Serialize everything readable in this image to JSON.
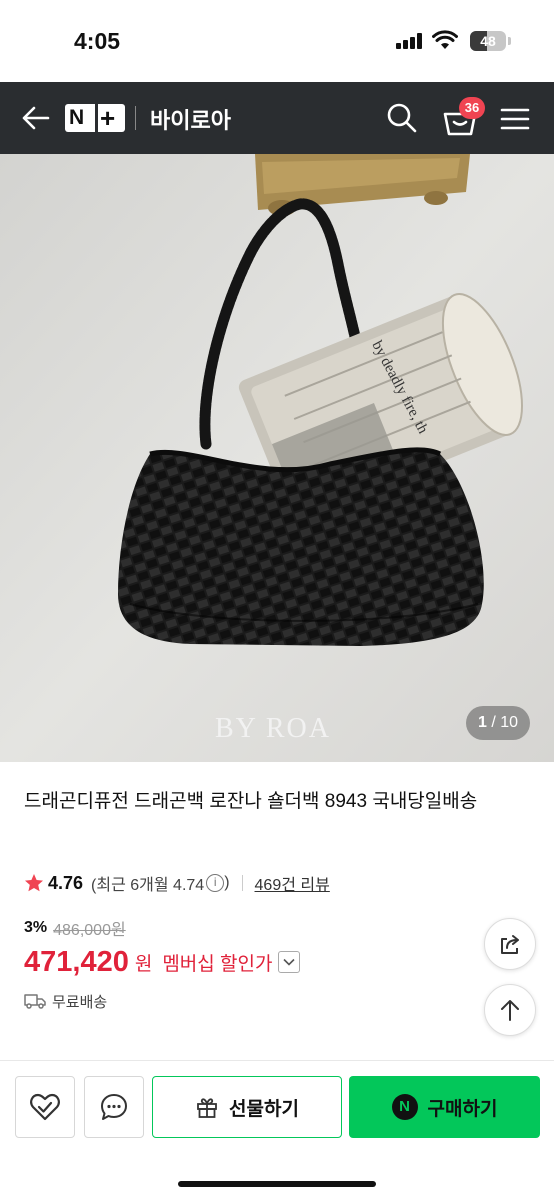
{
  "status_bar": {
    "time": "4:05",
    "battery": "48",
    "battery_level": 0.48
  },
  "header": {
    "back_icon": "arrow-left-icon",
    "logo_n": "N",
    "logo_plus": "+",
    "store_name": "바이로아",
    "cart_count": "36",
    "colors": {
      "background": "#2a2d30",
      "badge": "#f04452"
    }
  },
  "image": {
    "watermark": "BY ROA",
    "newspaper_text": "by deadly fire, th",
    "counter_current": "1",
    "counter_total": "/ 10"
  },
  "product": {
    "title": "드래곤디퓨전 드래곤백 로잔나 숄더백 8943 국내당일배송",
    "rating": "4.76",
    "recent_rating": "(최근 6개월 4.74",
    "recent_rating_close": ")",
    "info_mark": "i",
    "reviews": "469건 리뷰",
    "discount_rate": "3%",
    "original_price": "486,000원",
    "price": "471,420",
    "price_unit": "원",
    "price_label": "멤버십 할인가",
    "shipping": "무료배송",
    "colors": {
      "price": "#e0223a",
      "star": "#f04452"
    }
  },
  "bottom_bar": {
    "gift_label": "선물하기",
    "buy_label": "구매하기",
    "buy_logo": "N",
    "colors": {
      "primary": "#03c75a"
    }
  }
}
